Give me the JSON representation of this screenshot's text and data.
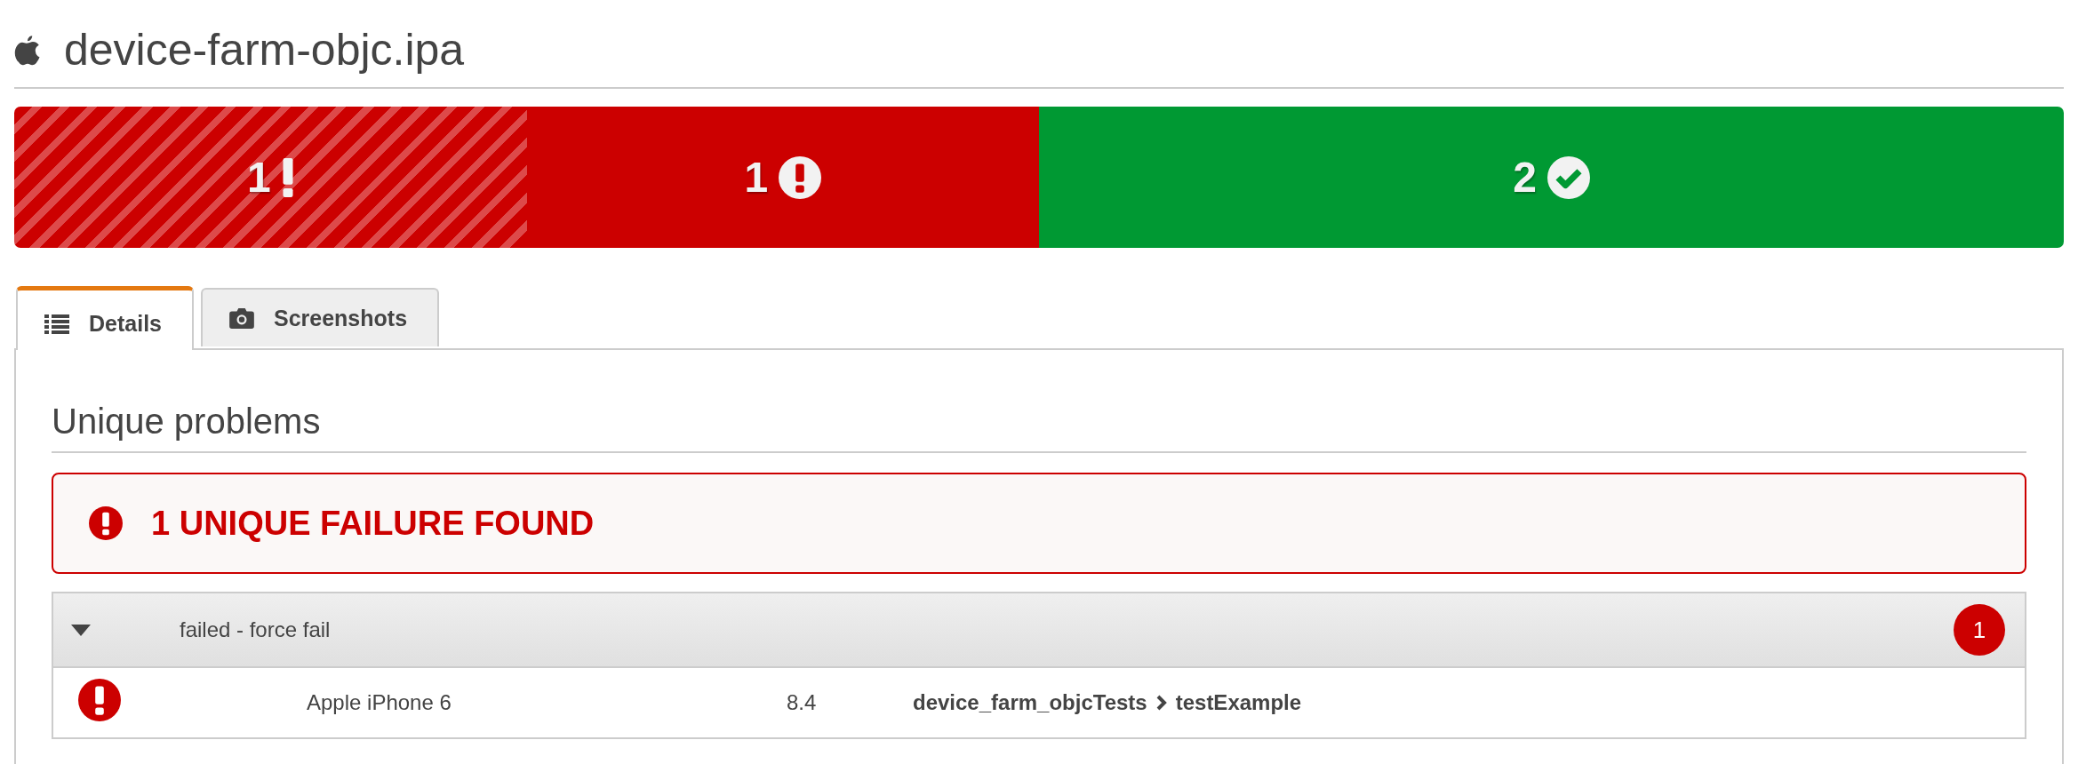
{
  "title": "device-farm-objc.ipa",
  "summary": [
    {
      "kind": "warning",
      "count": "1"
    },
    {
      "kind": "failed",
      "count": "1"
    },
    {
      "kind": "passed",
      "count": "2"
    }
  ],
  "tabs": [
    {
      "label": "Details",
      "kind": "list",
      "selected": true
    },
    {
      "label": "Screenshots",
      "kind": "camera",
      "selected": false
    }
  ],
  "section_title": "Unique problems",
  "alert": {
    "text": "1 UNIQUE FAILURE FOUND"
  },
  "groups": [
    {
      "label": "failed - force fail",
      "count": "1",
      "expanded": true,
      "rows": [
        {
          "kind": "failed",
          "device": "Apple iPhone 6",
          "os": "8.4",
          "suite": "device_farm_objcTests",
          "test": "testExample"
        }
      ]
    }
  ]
}
